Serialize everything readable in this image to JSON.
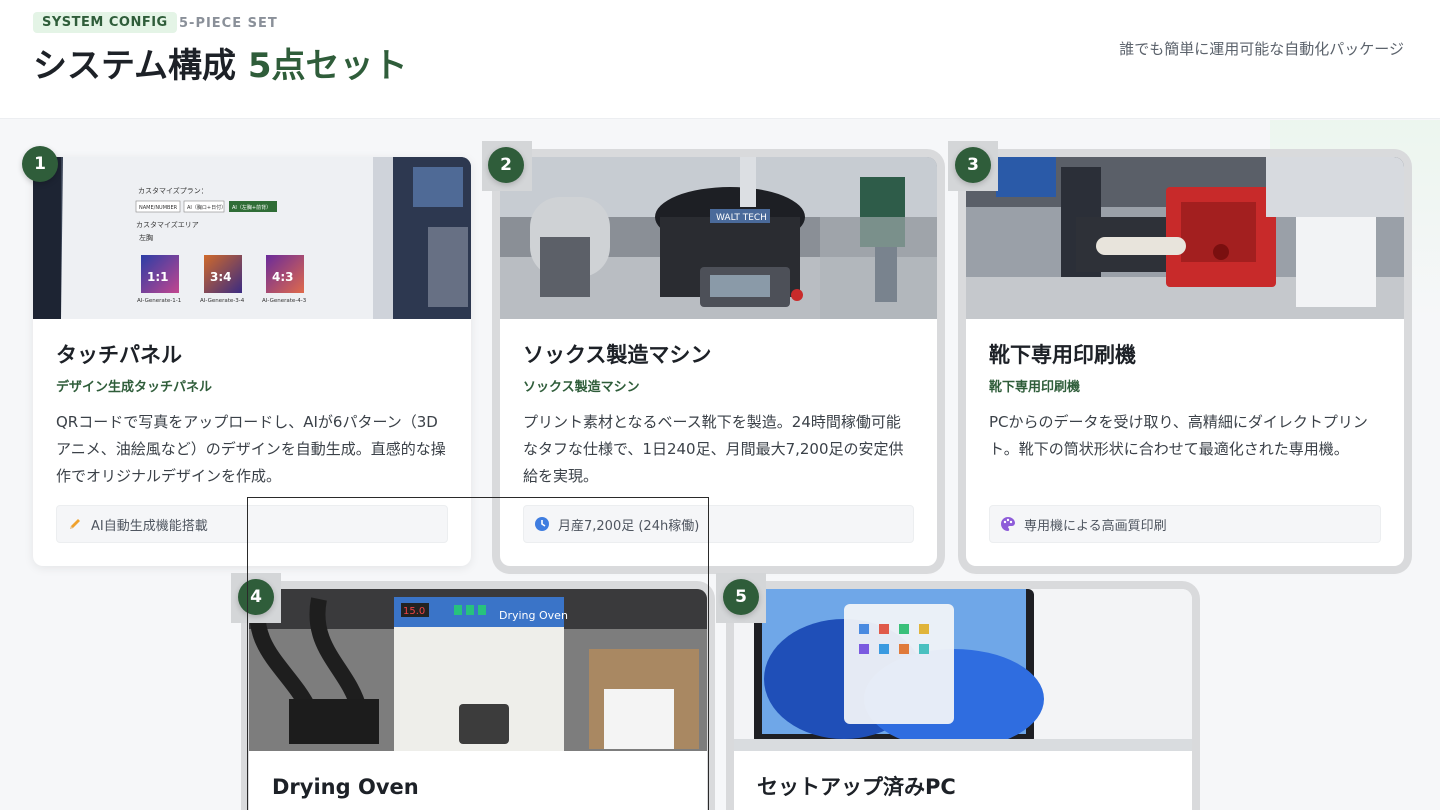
{
  "header": {
    "badge": "SYSTEM CONFIG",
    "sub_badge": "5-PIECE SET",
    "title_main": "システム構成 ",
    "title_accent": "5点セット",
    "tagline": "誰でも簡単に運用可能な自動化パッケージ"
  },
  "colors": {
    "accent": "#2f5d3a",
    "badge_bg": "#e4f4e6"
  },
  "cards": [
    {
      "number": "1",
      "title": "タッチパネル",
      "subtitle": "デザイン生成タッチパネル",
      "description": "QRコードで写真をアップロードし、AIが6パターン（3Dアニメ、油絵風など）のデザインを自動生成。直感的な操作でオリジナルデザインを作成。",
      "feature": "AI自動生成機能搭載",
      "feature_icon": "pencil-icon",
      "photo": {
        "plan_label": "カスタマイズプラン：",
        "options": [
          "NAME/NUMBER",
          "AI（胸ロ+日付）",
          "AI（左胸+前背）"
        ],
        "area_label": "カスタマイズエリア",
        "area_value": "左胸",
        "tiles": [
          {
            "ratio": "1:1",
            "caption": "AI-Generate-1-1"
          },
          {
            "ratio": "3:4",
            "caption": "AI-Generate-3-4"
          },
          {
            "ratio": "4:3",
            "caption": "AI-Generate-4-3"
          }
        ]
      }
    },
    {
      "number": "2",
      "title": "ソックス製造マシン",
      "subtitle": "ソックス製造マシン",
      "description": "プリント素材となるベース靴下を製造。24時間稼働可能なタフな仕様で、1日240足、月間最大7,200足の安定供給を実現。",
      "feature": "月産7,200足 (24h稼働)",
      "feature_icon": "clock-icon",
      "photo": {
        "brand": "WALT TECH"
      }
    },
    {
      "number": "3",
      "title": "靴下専用印刷機",
      "subtitle": "靴下専用印刷機",
      "description": "PCからのデータを受け取り、高精細にダイレクトプリント。靴下の筒状形状に合わせて最適化された専用機。",
      "feature": "専用機による高画質印刷",
      "feature_icon": "palette-icon"
    },
    {
      "number": "4",
      "title": "Drying Oven",
      "photo": {
        "label": "Drying Oven",
        "display": "15.0"
      }
    },
    {
      "number": "5",
      "title": "セットアップ済みPC"
    }
  ]
}
